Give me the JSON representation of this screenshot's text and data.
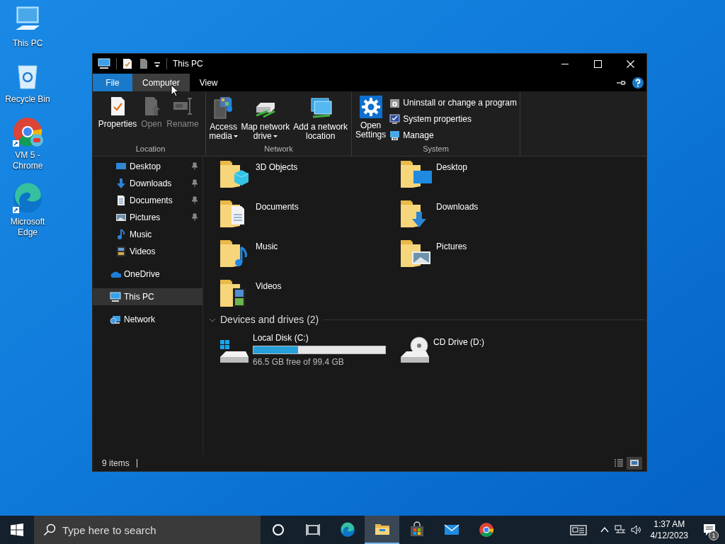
{
  "desktop_icons": [
    {
      "label": "This PC",
      "kind": "pc"
    },
    {
      "label": "Recycle Bin",
      "kind": "bin"
    },
    {
      "label": "VM 5 - Chrome",
      "kind": "chrome"
    },
    {
      "label": "Microsoft Edge",
      "kind": "edge"
    }
  ],
  "window": {
    "title": "This PC",
    "tabs": [
      {
        "label": "File",
        "kind": "file",
        "selected": false
      },
      {
        "label": "Computer",
        "kind": "tab",
        "selected": true
      },
      {
        "label": "View",
        "kind": "tab",
        "selected": false
      }
    ],
    "ribbon_groups": [
      {
        "label": "Location",
        "items": [
          {
            "label": "Properties",
            "kind": "properties",
            "disabled": false,
            "dropdown": false
          },
          {
            "label": "Open",
            "kind": "open",
            "disabled": true,
            "dropdown": false
          },
          {
            "label": "Rename",
            "kind": "rename",
            "disabled": true,
            "dropdown": false
          }
        ]
      },
      {
        "label": "Network",
        "items": [
          {
            "label": "Access media",
            "kind": "media",
            "disabled": false,
            "dropdown": true
          },
          {
            "label": "Map network drive",
            "kind": "mapdrive",
            "disabled": false,
            "dropdown": true
          },
          {
            "label": "Add a network location",
            "kind": "netloc",
            "disabled": false,
            "dropdown": false
          }
        ]
      },
      {
        "label": "System",
        "items": [
          {
            "label": "Open Settings",
            "kind": "settings",
            "disabled": false,
            "dropdown": false
          },
          {
            "label": "Uninstall or change a program",
            "kind": "uninstall",
            "disabled": false,
            "dropdown": false
          },
          {
            "label": "System properties",
            "kind": "sysprops",
            "disabled": false,
            "dropdown": false
          },
          {
            "label": "Manage",
            "kind": "manage",
            "disabled": false,
            "dropdown": false
          }
        ]
      }
    ],
    "quick_access_items": [
      {
        "label": "Desktop",
        "kind": "desktop",
        "pinned": true
      },
      {
        "label": "Downloads",
        "kind": "downloads",
        "pinned": true
      },
      {
        "label": "Documents",
        "kind": "documents",
        "pinned": true
      },
      {
        "label": "Pictures",
        "kind": "pictures",
        "pinned": true
      },
      {
        "label": "Music",
        "kind": "music",
        "pinned": false
      },
      {
        "label": "Videos",
        "kind": "videos",
        "pinned": false
      }
    ],
    "nav_items": [
      {
        "label": "OneDrive",
        "kind": "onedrive",
        "selected": false
      },
      {
        "label": "This PC",
        "kind": "pc",
        "selected": true
      },
      {
        "label": "Network",
        "kind": "network",
        "selected": false
      }
    ],
    "folders": [
      {
        "label": "3D Objects",
        "kind": "objects"
      },
      {
        "label": "Desktop",
        "kind": "desktop"
      },
      {
        "label": "Documents",
        "kind": "documents"
      },
      {
        "label": "Downloads",
        "kind": "downloads"
      },
      {
        "label": "Music",
        "kind": "music"
      },
      {
        "label": "Pictures",
        "kind": "pictures"
      },
      {
        "label": "Videos",
        "kind": "videos"
      }
    ],
    "devices": {
      "header": "Devices and drives (2)",
      "expanded": true,
      "drives": [
        {
          "name": "Local Disk (C:)",
          "kind": "hdd",
          "level": 0.34,
          "info": "66.5 GB free of 99.4 GB"
        },
        {
          "name": "CD Drive (D:)",
          "kind": "cd"
        }
      ]
    },
    "status_bar": {
      "count": "9 items",
      "views": [
        {
          "kind": "details",
          "selected": false
        },
        {
          "kind": "large-icons",
          "selected": true
        }
      ]
    }
  },
  "taskbar": {
    "search_placeholder": "Type here to search",
    "apps": [
      {
        "kind": "cortana",
        "active": false
      },
      {
        "kind": "taskview",
        "active": false
      },
      {
        "kind": "edge",
        "active": false
      },
      {
        "kind": "explorer",
        "active": true
      },
      {
        "kind": "store",
        "active": false
      },
      {
        "kind": "mail",
        "active": false
      },
      {
        "kind": "chrome",
        "active": false
      }
    ],
    "time": "1:37 AM",
    "date": "4/12/2023",
    "notification_count": "1"
  }
}
